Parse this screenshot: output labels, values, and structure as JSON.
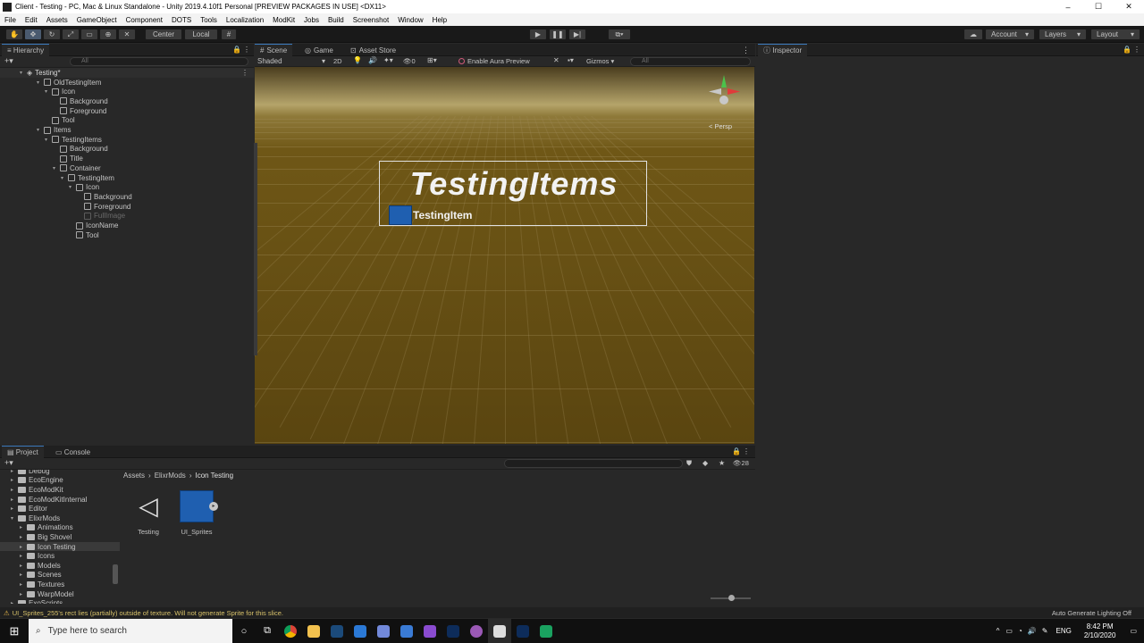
{
  "window": {
    "title": "Client - Testing - PC, Mac & Linux Standalone - Unity 2019.4.10f1 Personal [PREVIEW PACKAGES IN USE] <DX11>",
    "minimize": "–",
    "maximize": "☐",
    "close": "✕"
  },
  "menu": [
    "File",
    "Edit",
    "Assets",
    "GameObject",
    "Component",
    "DOTS",
    "Tools",
    "Localization",
    "ModKit",
    "Jobs",
    "Build",
    "Screenshot",
    "Window",
    "Help"
  ],
  "toolbar": {
    "center_label": "Center",
    "local_label": "Local",
    "account_label": "Account",
    "layers_label": "Layers",
    "layout_label": "Layout"
  },
  "hierarchy": {
    "tab": "Hierarchy",
    "search_placeholder": "All",
    "root": "Testing*",
    "items": [
      {
        "label": "OldTestingItem",
        "depth": 1,
        "expanded": true
      },
      {
        "label": "Icon",
        "depth": 2,
        "expanded": true
      },
      {
        "label": "Background",
        "depth": 3
      },
      {
        "label": "Foreground",
        "depth": 3
      },
      {
        "label": "Tool",
        "depth": 2
      },
      {
        "label": "Items",
        "depth": 1,
        "expanded": true
      },
      {
        "label": "TestingItems",
        "depth": 2,
        "expanded": true
      },
      {
        "label": "Background",
        "depth": 3
      },
      {
        "label": "Title",
        "depth": 3
      },
      {
        "label": "Container",
        "depth": 3,
        "expanded": true
      },
      {
        "label": "TestingItem",
        "depth": 4,
        "expanded": true
      },
      {
        "label": "Icon",
        "depth": 5,
        "expanded": true
      },
      {
        "label": "Background",
        "depth": 6
      },
      {
        "label": "Foreground",
        "depth": 6
      },
      {
        "label": "FullImage",
        "depth": 6,
        "dimmed": true
      },
      {
        "label": "IconName",
        "depth": 5
      },
      {
        "label": "Tool",
        "depth": 5
      }
    ]
  },
  "scene": {
    "tabs": [
      "Scene",
      "Game",
      "Asset Store"
    ],
    "shading": "Shaded",
    "mode_2d": "2D",
    "fx_count": "0",
    "aura_label": "Enable Aura Preview",
    "gizmos_label": "Gizmos",
    "search_placeholder": "All",
    "persp_label": "< Persp",
    "canvas_title": "TestingItems",
    "item_label": "TestingItem"
  },
  "inspector": {
    "tab": "Inspector"
  },
  "project": {
    "tabs": [
      "Project",
      "Console"
    ],
    "hidden_count": "28",
    "breadcrumb": [
      "Assets",
      "ElixrMods",
      "Icon Testing"
    ],
    "folders": [
      {
        "label": "Debug",
        "depth": 1
      },
      {
        "label": "EcoEngine",
        "depth": 1
      },
      {
        "label": "EcoModKit",
        "depth": 1
      },
      {
        "label": "EcoModKitInternal",
        "depth": 1
      },
      {
        "label": "Editor",
        "depth": 1
      },
      {
        "label": "ElixrMods",
        "depth": 1,
        "expanded": true
      },
      {
        "label": "Animations",
        "depth": 2
      },
      {
        "label": "Big Shovel",
        "depth": 2
      },
      {
        "label": "Icon Testing",
        "depth": 2,
        "selected": true
      },
      {
        "label": "Icons",
        "depth": 2
      },
      {
        "label": "Models",
        "depth": 2
      },
      {
        "label": "Scenes",
        "depth": 2
      },
      {
        "label": "Textures",
        "depth": 2
      },
      {
        "label": "WarpModel",
        "depth": 2
      },
      {
        "label": "ExoScripts",
        "depth": 1
      }
    ],
    "assets": [
      {
        "label": "Testing",
        "icon": "unity-scene-icon"
      },
      {
        "label": "UI_Sprites",
        "icon": "sprite-icon"
      }
    ]
  },
  "status": {
    "warning": "UI_Sprites_255's rect lies (partially) outside of texture. Will not generate Sprite for this slice.",
    "right": "Auto Generate Lighting Off"
  },
  "taskbar": {
    "search_placeholder": "Type here to search",
    "lang": "ENG",
    "time": "8:42 PM",
    "date": "2/10/2020"
  }
}
